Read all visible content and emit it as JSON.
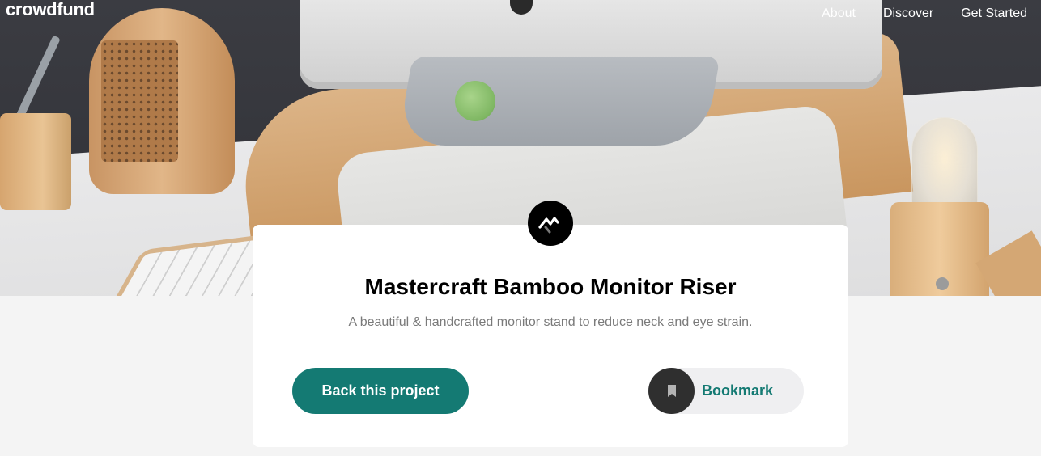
{
  "header": {
    "logo_text": "crowdfund",
    "nav": [
      {
        "label": "About"
      },
      {
        "label": "Discover"
      },
      {
        "label": "Get Started"
      }
    ]
  },
  "project": {
    "title": "Mastercraft Bamboo Monitor Riser",
    "description": "A beautiful & handcrafted monitor stand to reduce neck and eye strain.",
    "logo_icon": "mastercraft-logo-icon",
    "back_button_label": "Back this project",
    "bookmark_label": "Bookmark",
    "bookmark_icon": "bookmark-icon"
  },
  "colors": {
    "accent": "#147a73",
    "card_bg": "#ffffff",
    "page_bg": "#f4f4f4",
    "bookmark_circle": "#2f2f2f",
    "bookmark_bg": "#efeff1"
  }
}
